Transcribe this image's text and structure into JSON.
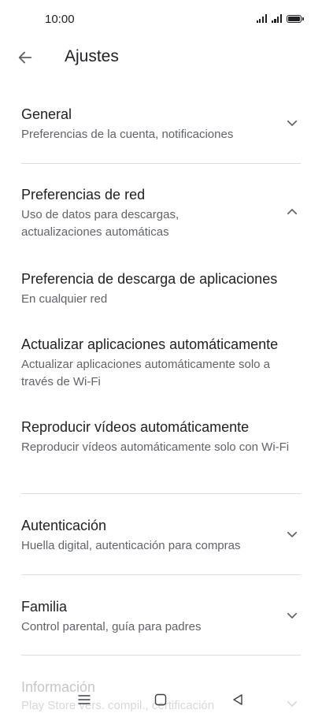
{
  "status_bar": {
    "time": "10:00"
  },
  "app_bar": {
    "title": "Ajustes"
  },
  "sections": {
    "general": {
      "title": "General",
      "subtitle": "Preferencias de la cuenta, notificaciones"
    },
    "network": {
      "title": "Preferencias de red",
      "subtitle": "Uso de datos para descargas, actualizaciones automáticas",
      "items": [
        {
          "title": "Preferencia de descarga de aplicaciones",
          "subtitle": "En cualquier red"
        },
        {
          "title": "Actualizar aplicaciones automáticamente",
          "subtitle": "Actualizar aplicaciones automáticamente solo a través de Wi-Fi"
        },
        {
          "title": "Reproducir vídeos automáticamente",
          "subtitle": "Reproducir vídeos automáticamente solo con Wi-Fi"
        }
      ]
    },
    "auth": {
      "title": "Autenticación",
      "subtitle": "Huella digital, autenticación para compras"
    },
    "family": {
      "title": "Familia",
      "subtitle": "Control parental, guía para padres"
    },
    "info": {
      "title": "Información",
      "subtitle": "Play Store vers. compil., certificación"
    }
  },
  "icons": {
    "back": "arrow-left-icon",
    "expand": "chevron-down-icon",
    "collapse": "chevron-up-icon",
    "nav_menu": "menu-icon",
    "nav_home": "square-home-icon",
    "nav_back": "triangle-back-icon"
  }
}
